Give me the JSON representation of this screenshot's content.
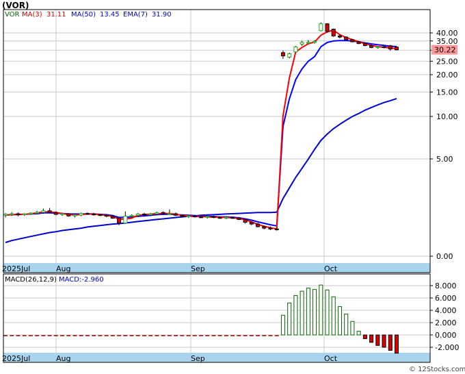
{
  "ticker": "(VOR)",
  "watermark": "© 12Stocks.com",
  "chart_data": [
    {
      "type": "candlestick",
      "title": "(VOR)",
      "scale": "log",
      "legend_placement": "top-left",
      "legend": {
        "symbol": "VOR",
        "ma3_label": "MA(3)",
        "ma3_value": "31.11",
        "ma50_label": "MA(50)",
        "ma50_value": "13.45",
        "ema7_label": "EMA(7)",
        "ema7_value": "31.90"
      },
      "last_price_label": "30.22",
      "last_price": 30.22,
      "y_ticks": [
        "40.00",
        "35.00",
        "30.00",
        "25.00",
        "20.00",
        "15.00",
        "10.00",
        "5.00",
        "0.00"
      ],
      "x_labels": [
        "2025Jul",
        "Aug",
        "Sep",
        "Oct"
      ],
      "grid": true,
      "candles": [
        [
          1.95,
          2.02,
          1.88,
          1.98
        ],
        [
          1.98,
          2.05,
          1.93,
          2.0
        ],
        [
          2.0,
          2.04,
          1.92,
          1.97
        ],
        [
          1.97,
          2.02,
          1.93,
          2.0
        ],
        [
          2.0,
          2.05,
          1.96,
          2.02
        ],
        [
          2.02,
          2.1,
          1.98,
          2.05
        ],
        [
          2.05,
          2.18,
          2.0,
          2.1
        ],
        [
          2.1,
          2.2,
          2.02,
          2.04
        ],
        [
          2.04,
          2.08,
          1.95,
          1.98
        ],
        [
          1.98,
          2.03,
          1.93,
          2.0
        ],
        [
          2.0,
          2.02,
          1.9,
          1.93
        ],
        [
          1.93,
          1.98,
          1.88,
          1.96
        ],
        [
          1.96,
          2.04,
          1.92,
          2.01
        ],
        [
          2.01,
          2.05,
          1.96,
          1.99
        ],
        [
          1.99,
          2.03,
          1.94,
          1.97
        ],
        [
          1.97,
          2.0,
          1.92,
          1.95
        ],
        [
          1.95,
          1.98,
          1.89,
          1.92
        ],
        [
          1.92,
          1.96,
          1.84,
          1.86
        ],
        [
          1.86,
          1.88,
          1.66,
          1.72
        ],
        [
          1.72,
          2.08,
          1.7,
          1.92
        ],
        [
          1.92,
          1.98,
          1.88,
          1.95
        ],
        [
          1.95,
          2.02,
          1.9,
          1.99
        ],
        [
          1.99,
          2.03,
          1.93,
          1.97
        ],
        [
          1.97,
          2.03,
          1.92,
          2.0
        ],
        [
          2.0,
          2.07,
          1.96,
          2.04
        ],
        [
          2.04,
          2.08,
          1.97,
          2.0
        ],
        [
          2.0,
          2.15,
          1.98,
          2.0
        ],
        [
          2.0,
          2.04,
          1.93,
          1.95
        ],
        [
          1.95,
          1.97,
          1.88,
          1.91
        ],
        [
          1.91,
          1.95,
          1.87,
          1.93
        ],
        [
          1.93,
          1.96,
          1.88,
          1.9
        ],
        [
          1.9,
          1.93,
          1.86,
          1.89
        ],
        [
          1.89,
          1.93,
          1.85,
          1.91
        ],
        [
          1.91,
          1.94,
          1.86,
          1.88
        ],
        [
          1.88,
          1.91,
          1.84,
          1.87
        ],
        [
          1.87,
          1.9,
          1.83,
          1.88
        ],
        [
          1.88,
          1.91,
          1.84,
          1.86
        ],
        [
          1.86,
          1.88,
          1.8,
          1.82
        ],
        [
          1.82,
          1.84,
          1.7,
          1.74
        ],
        [
          1.74,
          1.77,
          1.66,
          1.69
        ],
        [
          1.69,
          1.72,
          1.6,
          1.62
        ],
        [
          1.62,
          1.65,
          1.55,
          1.58
        ],
        [
          1.58,
          1.62,
          1.53,
          1.56
        ],
        [
          1.56,
          1.6,
          1.52,
          1.55
        ],
        [
          28.8,
          29.8,
          26.0,
          27.3
        ],
        [
          26.8,
          28.8,
          26.2,
          28.3
        ],
        [
          29.2,
          32.2,
          29.0,
          31.7
        ],
        [
          33.2,
          35.0,
          32.2,
          34.2
        ],
        [
          34.2,
          35.5,
          33.5,
          34.2
        ],
        [
          34.2,
          35.4,
          33.5,
          34.7
        ],
        [
          41.5,
          47.5,
          41.0,
          46.5
        ],
        [
          46.5,
          47.0,
          40.0,
          41.0
        ],
        [
          42.5,
          43.0,
          37.5,
          38.0
        ],
        [
          38.0,
          39.0,
          36.5,
          37.3
        ],
        [
          37.3,
          37.8,
          35.5,
          35.7
        ],
        [
          35.7,
          36.0,
          34.2,
          34.5
        ],
        [
          34.5,
          35.0,
          33.2,
          33.5
        ],
        [
          33.5,
          34.0,
          32.0,
          32.4
        ],
        [
          32.4,
          33.0,
          31.0,
          31.4
        ],
        [
          31.4,
          32.0,
          30.8,
          31.8
        ],
        [
          31.8,
          32.5,
          31.0,
          31.3
        ],
        [
          32.3,
          32.8,
          29.8,
          30.6
        ],
        [
          31.6,
          32.0,
          30.0,
          30.22
        ]
      ],
      "ma3": [
        1.95,
        1.97,
        1.98,
        1.98,
        2.0,
        2.03,
        2.06,
        2.06,
        2.04,
        2.01,
        1.97,
        1.96,
        1.97,
        1.99,
        1.99,
        1.97,
        1.95,
        1.91,
        1.83,
        1.83,
        1.86,
        1.95,
        1.97,
        1.99,
        2.0,
        2.01,
        2.01,
        1.98,
        1.95,
        1.93,
        1.91,
        1.91,
        1.9,
        1.89,
        1.89,
        1.88,
        1.87,
        1.85,
        1.81,
        1.75,
        1.68,
        1.63,
        1.59,
        1.56,
        10.14,
        18.98,
        29.1,
        31.4,
        33.37,
        34.37,
        38.5,
        40.7,
        41.8,
        38.8,
        37.0,
        35.8,
        34.5,
        33.5,
        32.4,
        31.9,
        31.5,
        31.2,
        30.7
      ],
      "ema7": [
        1.96,
        1.97,
        1.97,
        1.98,
        1.99,
        2.0,
        2.03,
        2.03,
        2.02,
        2.01,
        1.99,
        1.99,
        1.99,
        1.99,
        1.99,
        1.98,
        1.97,
        1.94,
        1.88,
        1.89,
        1.9,
        1.92,
        1.93,
        1.95,
        1.97,
        1.98,
        1.98,
        1.97,
        1.96,
        1.95,
        1.94,
        1.93,
        1.92,
        1.91,
        1.9,
        1.9,
        1.89,
        1.87,
        1.84,
        1.8,
        1.75,
        1.71,
        1.67,
        1.64,
        8.5,
        13.4,
        18.4,
        22.0,
        25.0,
        27.0,
        31.8,
        34.1,
        35.0,
        35.2,
        35.2,
        35.0,
        34.5,
        33.9,
        33.3,
        32.9,
        32.5,
        32.0,
        31.9
      ],
      "ma50": [
        1.25,
        1.29,
        1.32,
        1.35,
        1.38,
        1.41,
        1.44,
        1.47,
        1.49,
        1.52,
        1.54,
        1.56,
        1.58,
        1.61,
        1.63,
        1.65,
        1.67,
        1.69,
        1.7,
        1.72,
        1.74,
        1.76,
        1.78,
        1.8,
        1.82,
        1.84,
        1.86,
        1.88,
        1.9,
        1.92,
        1.93,
        1.95,
        1.96,
        1.97,
        1.98,
        1.99,
        2.0,
        2.01,
        2.02,
        2.03,
        2.04,
        2.04,
        2.04,
        2.05,
        2.58,
        3.08,
        3.67,
        4.27,
        4.98,
        5.85,
        6.76,
        7.5,
        8.2,
        8.8,
        9.4,
        10.0,
        10.5,
        11.1,
        11.6,
        12.1,
        12.6,
        13.0,
        13.45
      ]
    },
    {
      "type": "bar",
      "title": "MACD(26,12,9)",
      "legend": {
        "name_label": "MACD(26,12,9)",
        "value_label": "MACD:-2.960"
      },
      "y_ticks": [
        "8.000",
        "6.000",
        "4.000",
        "2.000",
        "0.000",
        "-2.000"
      ],
      "x_labels": [
        "2025Jul",
        "Aug",
        "Sep",
        "Oct"
      ],
      "grid": true,
      "values": [
        -0.02,
        -0.02,
        -0.02,
        -0.02,
        -0.02,
        -0.02,
        -0.02,
        -0.02,
        -0.02,
        -0.02,
        -0.02,
        -0.02,
        -0.02,
        -0.02,
        -0.02,
        -0.02,
        -0.02,
        -0.02,
        -0.05,
        -0.04,
        -0.02,
        -0.02,
        -0.02,
        -0.02,
        -0.02,
        -0.02,
        -0.02,
        -0.02,
        -0.02,
        -0.02,
        -0.02,
        -0.02,
        -0.02,
        -0.02,
        -0.02,
        -0.02,
        -0.02,
        -0.02,
        -0.02,
        -0.02,
        -0.02,
        -0.02,
        -0.02,
        -0.02,
        3.2,
        5.2,
        6.4,
        7.1,
        7.6,
        7.4,
        8.1,
        7.3,
        6.2,
        4.6,
        3.4,
        2.2,
        0.6,
        -0.6,
        -1.2,
        -1.7,
        -2.0,
        -2.5,
        -2.96
      ]
    }
  ],
  "colors": {
    "up_candle": "#22aa22",
    "down_candle": "#dd0000",
    "ma3_line": "#ff0000",
    "ema7_line": "#0000ff",
    "ma50_line": "#0000cc",
    "macd_up": "#006600",
    "macd_down": "#dd0000",
    "grid": "#c8c8c8",
    "axis_strip": "#a9d4ee",
    "last_price_bg": "#ff9999"
  }
}
